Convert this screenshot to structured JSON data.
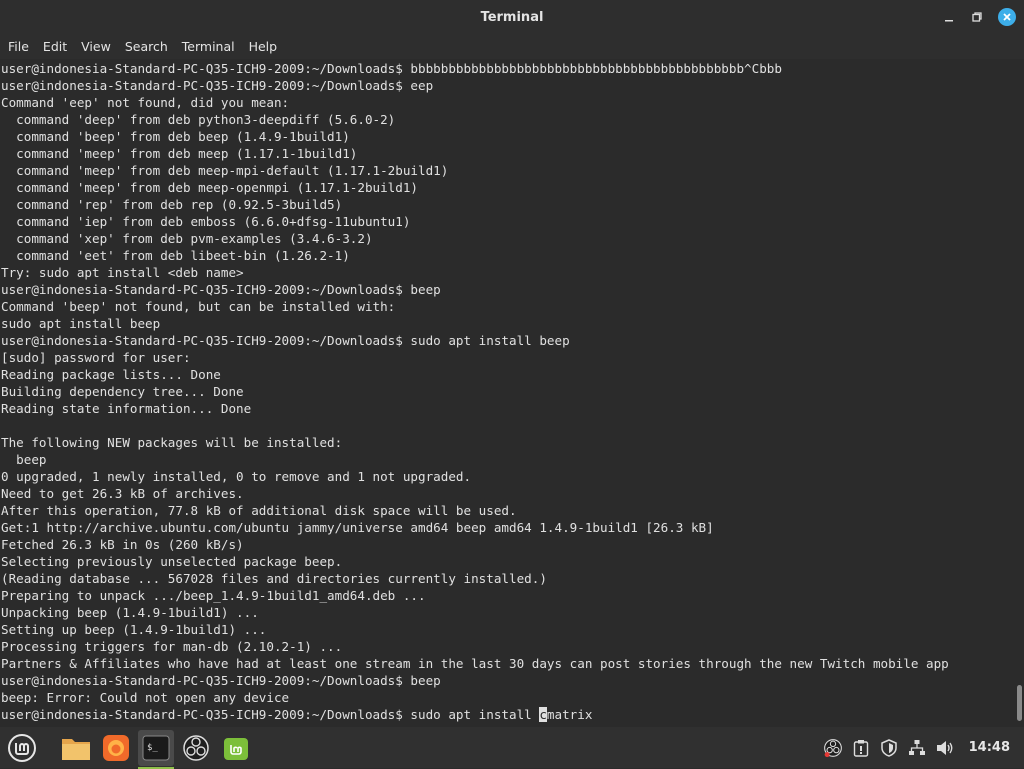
{
  "window": {
    "title": "Terminal",
    "controls": {
      "minimize": "🗕",
      "maximize": "🗗",
      "close": "✕"
    }
  },
  "menu": [
    "File",
    "Edit",
    "View",
    "Search",
    "Terminal",
    "Help"
  ],
  "terminal": {
    "lines": [
      "user@indonesia-Standard-PC-Q35-ICH9-2009:~/Downloads$ bbbbbbbbbbbbbbbbbbbbbbbbbbbbbbbbbbbbbbbbbbbb^Cbbb",
      "user@indonesia-Standard-PC-Q35-ICH9-2009:~/Downloads$ eep",
      "Command 'eep' not found, did you mean:",
      "  command 'deep' from deb python3-deepdiff (5.6.0-2)",
      "  command 'beep' from deb beep (1.4.9-1build1)",
      "  command 'meep' from deb meep (1.17.1-1build1)",
      "  command 'meep' from deb meep-mpi-default (1.17.1-2build1)",
      "  command 'meep' from deb meep-openmpi (1.17.1-2build1)",
      "  command 'rep' from deb rep (0.92.5-3build5)",
      "  command 'iep' from deb emboss (6.6.0+dfsg-11ubuntu1)",
      "  command 'xep' from deb pvm-examples (3.4.6-3.2)",
      "  command 'eet' from deb libeet-bin (1.26.2-1)",
      "Try: sudo apt install <deb name>",
      "user@indonesia-Standard-PC-Q35-ICH9-2009:~/Downloads$ beep",
      "Command 'beep' not found, but can be installed with:",
      "sudo apt install beep",
      "user@indonesia-Standard-PC-Q35-ICH9-2009:~/Downloads$ sudo apt install beep",
      "[sudo] password for user:",
      "Reading package lists... Done",
      "Building dependency tree... Done",
      "Reading state information... Done",
      "",
      "The following NEW packages will be installed:",
      "  beep",
      "0 upgraded, 1 newly installed, 0 to remove and 1 not upgraded.",
      "Need to get 26.3 kB of archives.",
      "After this operation, 77.8 kB of additional disk space will be used.",
      "Get:1 http://archive.ubuntu.com/ubuntu jammy/universe amd64 beep amd64 1.4.9-1build1 [26.3 kB]",
      "Fetched 26.3 kB in 0s (260 kB/s)",
      "Selecting previously unselected package beep.",
      "(Reading database ... 567028 files and directories currently installed.)",
      "Preparing to unpack .../beep_1.4.9-1build1_amd64.deb ...",
      "Unpacking beep (1.4.9-1build1) ...",
      "Setting up beep (1.4.9-1build1) ...",
      "Processing triggers for man-db (2.10.2-1) ...",
      "Partners & Affiliates who have had at least one stream in the last 30 days can post stories through the new Twitch mobile app",
      "user@indonesia-Standard-PC-Q35-ICH9-2009:~/Downloads$ beep",
      "beep: Error: Could not open any device"
    ],
    "prompt_line": {
      "before_cursor": "user@indonesia-Standard-PC-Q35-ICH9-2009:~/Downloads$ sudo apt install ",
      "cursor_char": "c",
      "after_cursor": "matrix"
    }
  },
  "taskbar": {
    "apps": [
      {
        "name": "menu",
        "icon": "linux-mint-menu-icon"
      },
      {
        "name": "files",
        "icon": "folder-icon"
      },
      {
        "name": "firefox",
        "icon": "firefox-icon"
      },
      {
        "name": "terminal",
        "icon": "terminal-icon",
        "active": true,
        "glyph": "$_"
      },
      {
        "name": "obs",
        "icon": "obs-icon"
      },
      {
        "name": "mint-software",
        "icon": "mint-software-icon"
      }
    ],
    "tray": [
      {
        "icon": "obs-tray-icon"
      },
      {
        "icon": "clipboard-icon"
      },
      {
        "icon": "shield-icon"
      },
      {
        "icon": "network-icon"
      },
      {
        "icon": "volume-icon"
      }
    ],
    "clock": "14:48"
  },
  "colors": {
    "terminal_bg": "#2b2b2b",
    "terminal_fg": "#e0e0e0",
    "accent": "#3daee9",
    "mint_green": "#8fbf4a"
  }
}
